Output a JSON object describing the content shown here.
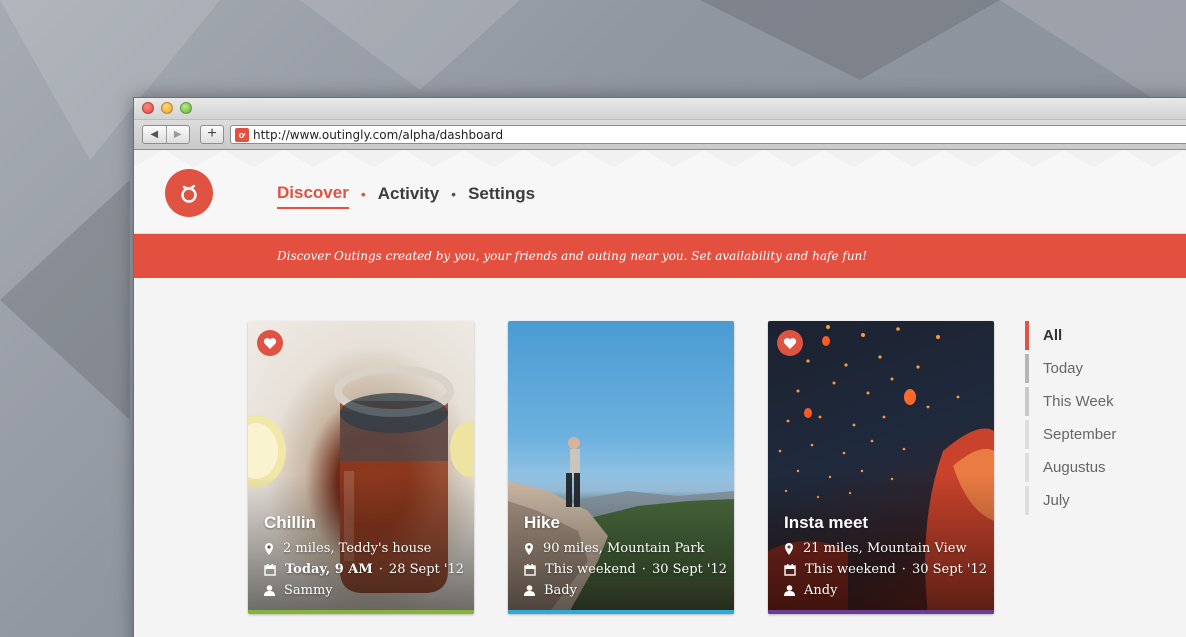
{
  "browser": {
    "url": "http://www.outingly.com/alpha/dashboard",
    "back_icon": "arrow-left-icon",
    "forward_icon": "arrow-right-icon",
    "new_tab_label": "+",
    "favicon_glyph": "ơ"
  },
  "header": {
    "logo_glyph": "ơ",
    "nav": [
      {
        "label": "Discover",
        "active": true
      },
      {
        "label": "Activity",
        "active": false
      },
      {
        "label": "Settings",
        "active": false
      }
    ]
  },
  "banner": {
    "text": "Discover Outings created by you, your friends and outing near you. Set availability and hafe fun!"
  },
  "cards": [
    {
      "title": "Chillin",
      "location": "2 miles, Teddy's house",
      "when_bold": "Today,  9 AM",
      "date": "28 Sept '12",
      "person": "Sammy",
      "stripe_color": "#86b23d",
      "favorite": true
    },
    {
      "title": "Hike",
      "location": "90 miles, Mountain Park",
      "when": "This weekend",
      "date": "30 Sept '12",
      "person": "Bady",
      "stripe_color": "#31a9d6",
      "favorite": false
    },
    {
      "title": "Insta meet",
      "location": "21 miles, Mountain View",
      "when": "This weekend",
      "date": "30 Sept '12",
      "person": "Andy",
      "stripe_color": "#6a3f93",
      "favorite": true
    }
  ],
  "filters": [
    "All",
    "Today",
    "This Week",
    "September",
    "Augustus",
    "July"
  ],
  "colors": {
    "accent": "#e05242"
  }
}
